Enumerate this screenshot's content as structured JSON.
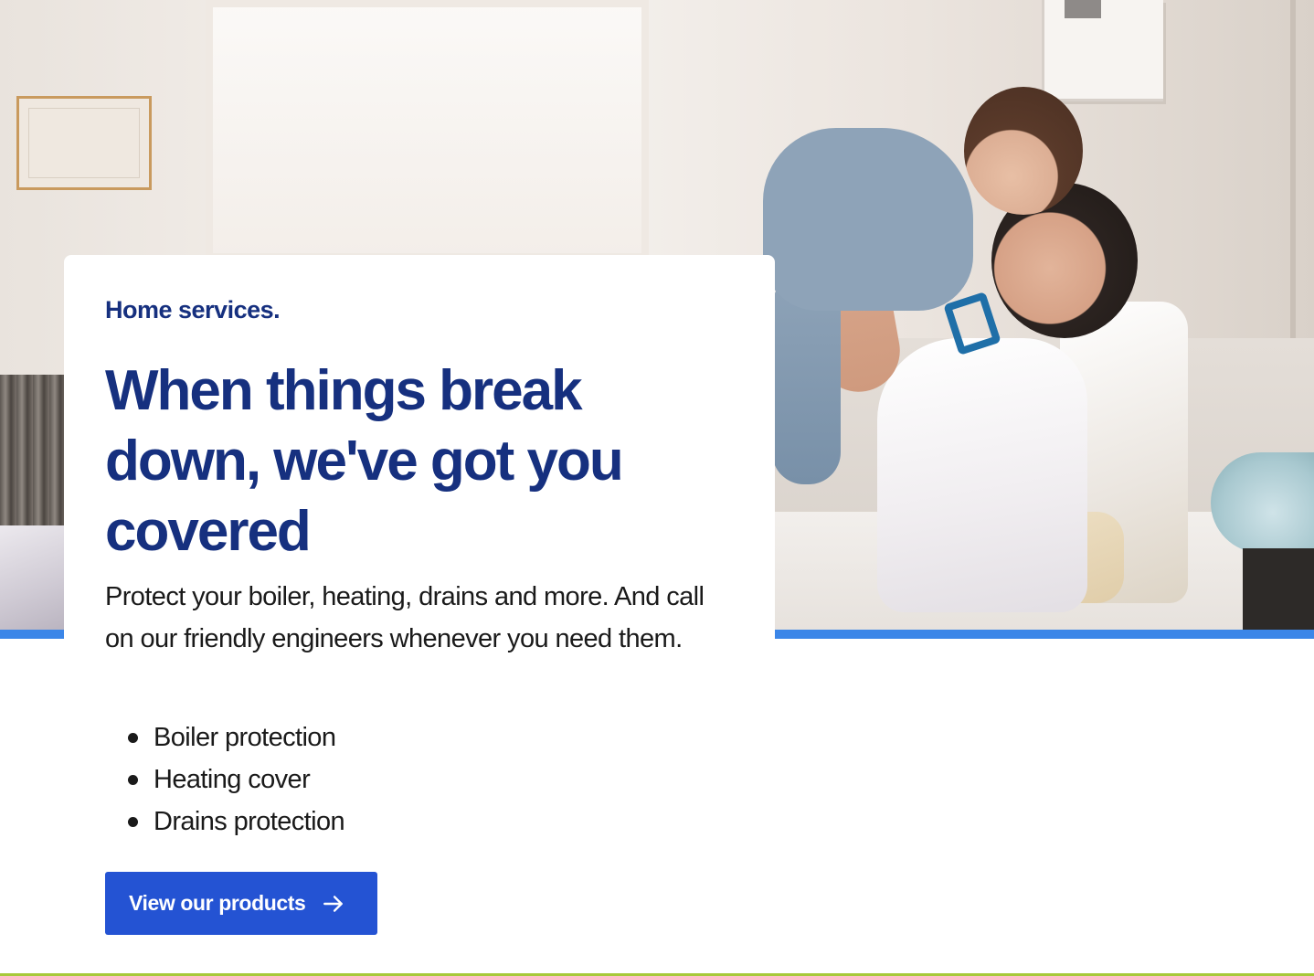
{
  "hero": {
    "image_icon": "family-photo"
  },
  "card": {
    "eyebrow": "Home services.",
    "headline": "When things break down, we've got you covered",
    "intro": "Protect your boiler, heating, drains and more. And call on our friendly engineers whenever you need them.",
    "features": [
      "Boiler protection",
      "Heating cover",
      "Drains protection"
    ],
    "cta": {
      "label": "View our products",
      "icon": "arrow-right-icon"
    }
  },
  "colors": {
    "brand_navy": "#16307f",
    "cta_blue": "#2453d3",
    "accent_band": "#3b86e8",
    "bottom_rule": "#a7c93a"
  }
}
